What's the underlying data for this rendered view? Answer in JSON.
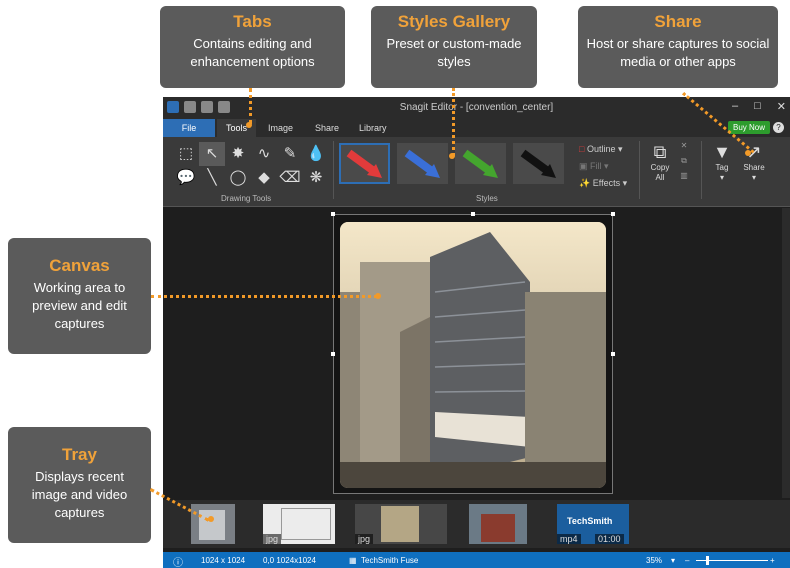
{
  "callouts": {
    "tabs": {
      "title": "Tabs",
      "desc": "Contains editing and enhancement options"
    },
    "styles": {
      "title": "Styles Gallery",
      "desc": "Preset or custom-made styles"
    },
    "share": {
      "title": "Share",
      "desc": "Host or share captures to social media or other apps"
    },
    "canvas": {
      "title": "Canvas",
      "desc": "Working area to preview and edit captures"
    },
    "tray": {
      "title": "Tray",
      "desc": "Displays recent image and video captures"
    }
  },
  "window": {
    "title": "Snagit Editor - [convention_center]"
  },
  "menu": {
    "file": "File",
    "tabs": [
      "Tools",
      "Image",
      "Share",
      "Library"
    ],
    "buy_now": "Buy Now",
    "help": "?"
  },
  "ribbon": {
    "drawing_tools_label": "Drawing Tools",
    "styles_label": "Styles",
    "style_colors": [
      "#e23b3b",
      "#3a6fd8",
      "#44a52e",
      "#111111"
    ],
    "format": {
      "outline": "Outline",
      "fill": "Fill",
      "effects": "Effects"
    },
    "copy_all": {
      "line1": "Copy",
      "line2": "All"
    },
    "tag": "Tag",
    "share": "Share"
  },
  "tray": {
    "items": [
      {
        "type": "",
        "icon": "building-thumb"
      },
      {
        "type": "jpg",
        "icon": "sketch-thumb"
      },
      {
        "type": "jpg",
        "icon": "convention-center-thumb"
      },
      {
        "type": "",
        "icon": "house-thumb"
      },
      {
        "type": "mp4",
        "duration": "01:00",
        "label": "TechSmith"
      }
    ]
  },
  "status": {
    "dimensions": "1024 x 1024",
    "selection": "0,0  1024x1024",
    "fuse": "TechSmith Fuse",
    "zoom": "35%"
  },
  "colors": {
    "accent": "#f29a28",
    "callout_bg": "#5b5b5b",
    "file_tab": "#2d6eb5",
    "status_bar": "#0f6fbf",
    "buy_now": "#2d9c2d"
  }
}
